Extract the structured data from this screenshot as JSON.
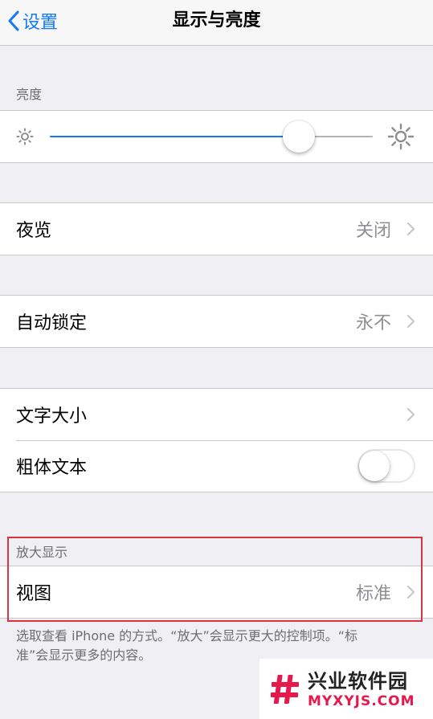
{
  "navbar": {
    "back_label": "设置",
    "title": "显示与亮度"
  },
  "brightness": {
    "header": "亮度",
    "level": 0.77
  },
  "night_shift": {
    "label": "夜览",
    "value": "关闭"
  },
  "auto_lock": {
    "label": "自动锁定",
    "value": "永不"
  },
  "text": {
    "text_size_label": "文字大小",
    "bold_text_label": "粗体文本",
    "bold_text_on": false
  },
  "zoom": {
    "header": "放大显示",
    "view_label": "视图",
    "view_value": "标准",
    "footer": "选取查看 iPhone 的方式。“放大”会显示更大的控制项。“标准”会显示更多的内容。"
  },
  "watermark": {
    "cn": "兴业软件园",
    "en": "MYXYJS.COM"
  },
  "colors": {
    "accent": "#1479f6",
    "highlight": "#d9343f",
    "watermark": "#e6194c"
  }
}
